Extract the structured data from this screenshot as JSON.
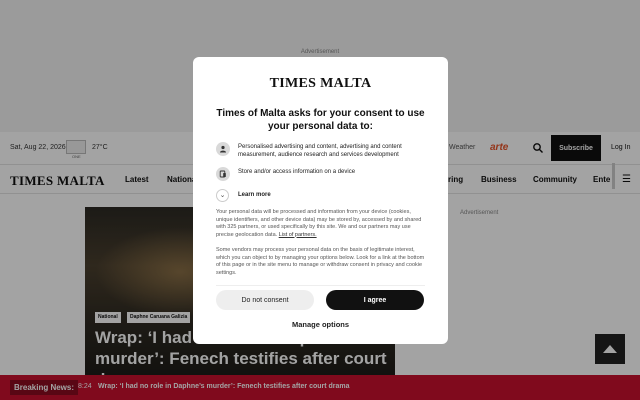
{
  "top_ad": {
    "label": "Advertisement"
  },
  "utility_bar": {
    "date": "Sat, Aug 22, 2026",
    "weather_icon_caption": "ONE",
    "temperature": "27°C",
    "weather_link": "Weather",
    "partner_logo": "arte",
    "subscribe_label": "Subscribe",
    "login_label": "Log In"
  },
  "main_nav": {
    "logo": "TIMES MALTA",
    "items": [
      "Latest",
      "National",
      "ring",
      "Business",
      "Community",
      "Ente"
    ]
  },
  "hero": {
    "tags": [
      "National",
      "Daphne Caruana Galizia"
    ],
    "headline": "Wrap: ‘I had no role in Daphne’s murder’: Fenech testifies after court drama"
  },
  "right_ad": {
    "label": "Advertisement"
  },
  "breaking_news": {
    "label": "Breaking News:",
    "time": "8:24",
    "headline": "Wrap: ‘I had no role in Daphne’s murder’: Fenech testifies after court drama"
  },
  "consent_dialog": {
    "logo": "TIMES MALTA",
    "title": "Times of Malta asks for your consent to use your personal data to:",
    "purposes": [
      {
        "icon": "person-icon",
        "text": "Personalised advertising and content, advertising and content measurement, audience research and services development"
      },
      {
        "icon": "device-icon",
        "text": "Store and/or access information on a device"
      }
    ],
    "learn_more": "Learn more",
    "paragraph1": "Your personal data will be processed and information from your device (cookies, unique identifiers, and other device data) may be stored by, accessed by and shared with 325 partners, or used specifically by this site. We and our partners may use precise geolocation data.",
    "paragraph1_link": "List of partners.",
    "paragraph2": "Some vendors may process your personal data on the basis of legitimate interest, which you can object to by managing your options below. Look for a link at the bottom of this page or in the site menu to manage or withdraw consent in privacy and cookie settings.",
    "do_not_consent_label": "Do not consent",
    "agree_label": "I agree",
    "manage_options_label": "Manage options"
  }
}
